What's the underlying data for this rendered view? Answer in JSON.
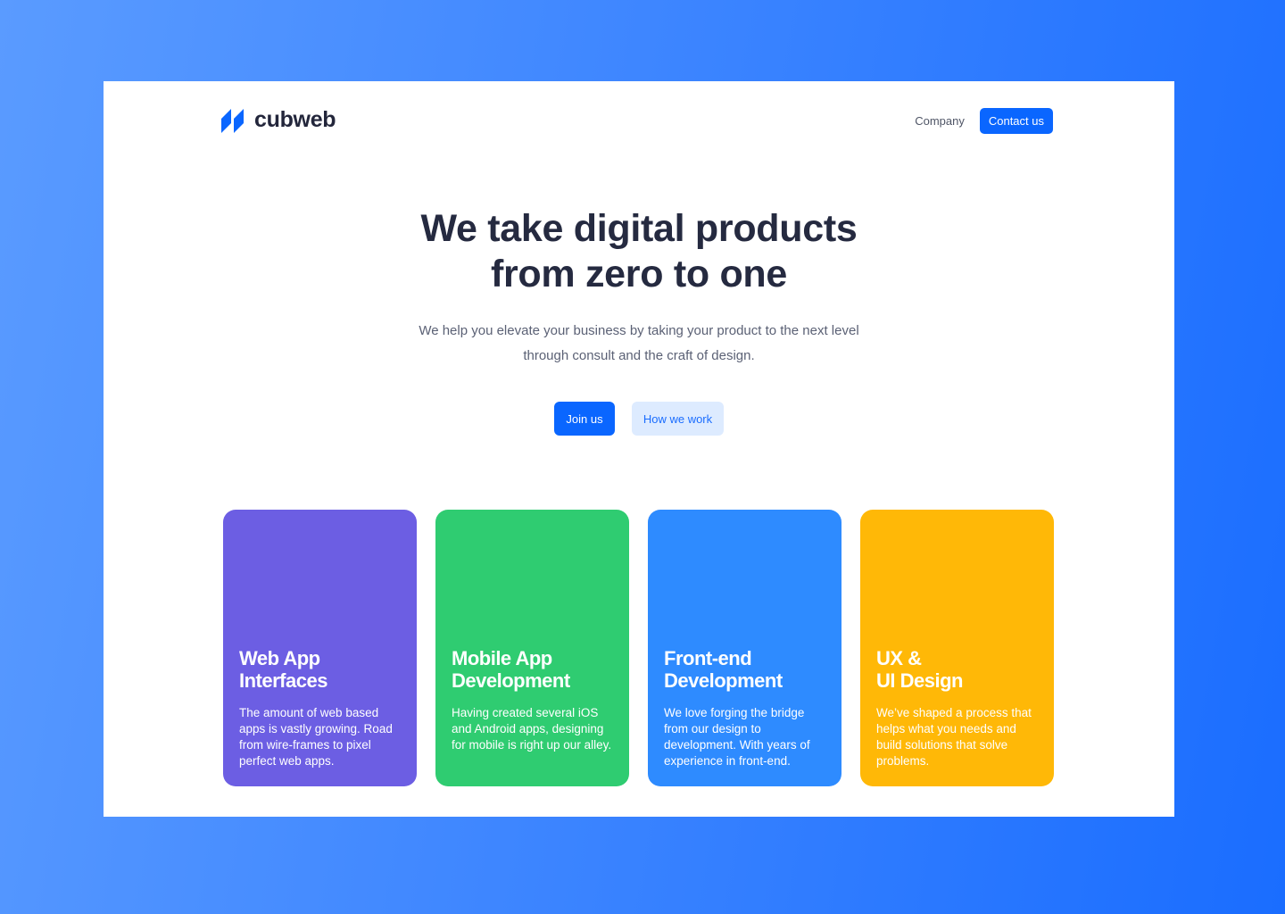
{
  "brand": {
    "name": "cubweb",
    "logo_icon": "cubweb-logo-icon",
    "accent_color": "#0a66ff"
  },
  "nav": {
    "company_label": "Company",
    "contact_label": "Contact us"
  },
  "hero": {
    "title_line1": "We take digital products",
    "title_line2": "from zero to one",
    "subtitle_line1": "We help you elevate your business by taking your product to the next level",
    "subtitle_line2": "through consult and the craft of design.",
    "primary_button": "Join us",
    "secondary_button": "How we work"
  },
  "cards": [
    {
      "title_line1": "Web App",
      "title_line2": "Interfaces",
      "description": "The amount of web based apps is vastly growing. Road from wire-frames to pixel perfect web apps.",
      "color": "#6c5ee3"
    },
    {
      "title_line1": "Mobile App",
      "title_line2": "Development",
      "description": "Having created several iOS and Android apps, designing for mobile is right up our alley.",
      "color": "#2fcc71"
    },
    {
      "title_line1": "Front-end",
      "title_line2": "Development",
      "description": "We love forging the bridge from our design to development. With years of experience in front-end.",
      "color": "#2e8bff"
    },
    {
      "title_line1": "UX &",
      "title_line2": "UI Design",
      "description": "We’ve shaped a process that helps what you needs and build solutions that solve problems.",
      "color": "#ffb807"
    }
  ]
}
